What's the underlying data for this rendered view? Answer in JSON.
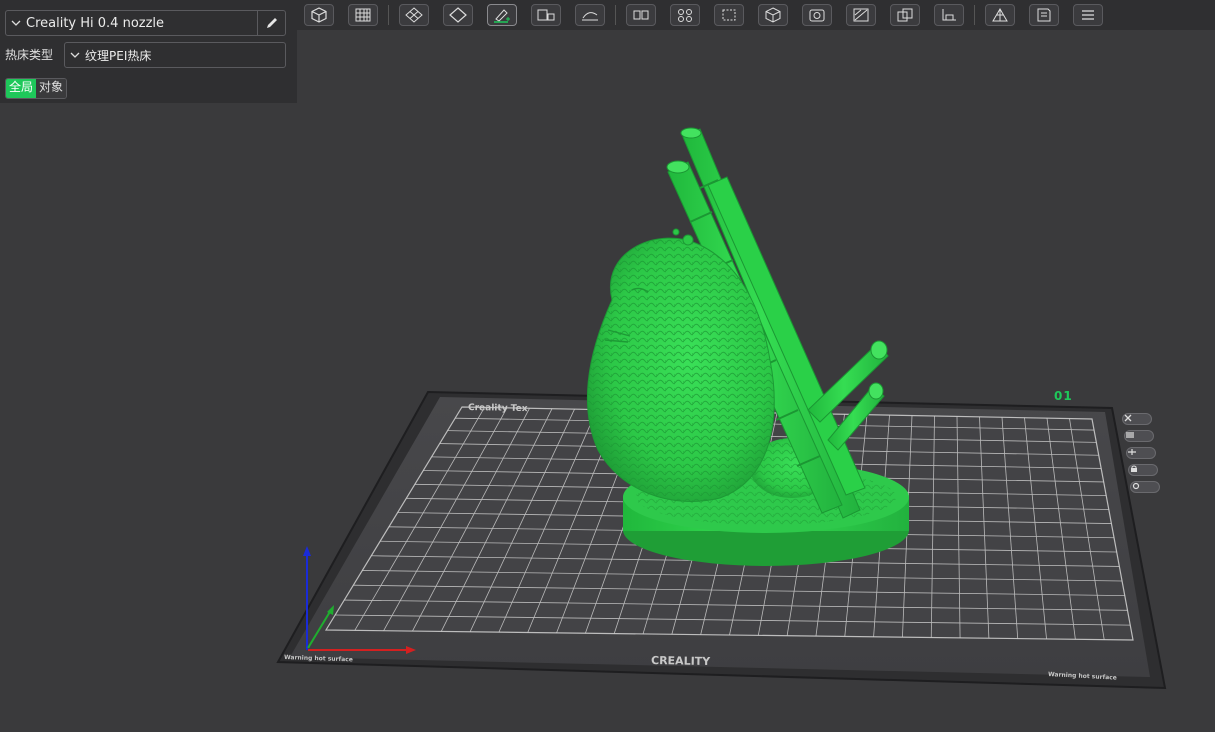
{
  "printer": {
    "name": "Creality Hi 0.4 nozzle",
    "chevron_icon": "chevron-down-icon",
    "edit_icon": "pencil-icon"
  },
  "bed": {
    "label": "热床类型",
    "value": "纹理PEI热床"
  },
  "scope": {
    "global_label": "全局",
    "object_label": "对象",
    "active": "global"
  },
  "toolbar": {
    "icons": [
      "cube-icon",
      "grid-icon",
      "diamond-grid-icon",
      "diamond-icon",
      "pen-add-icon",
      "layout-icon",
      "curve-icon",
      "split-icon",
      "arrange-icon",
      "frame-icon",
      "cube-view-icon",
      "camera-icon",
      "slash-icon",
      "stack-icon",
      "plane-icon",
      "mesh-icon",
      "book-icon",
      "menu-icon"
    ]
  },
  "plate": {
    "label": "01",
    "brand": "CREALITY",
    "text_top_left": "Creality Tex",
    "warning_left": "Warning hot surface",
    "warning_right": "Warning hot surface"
  },
  "colors": {
    "model_green": "#2fd64f",
    "accent": "#1ec85a",
    "background": "#3a3a3c",
    "panel": "#2f2f31"
  }
}
